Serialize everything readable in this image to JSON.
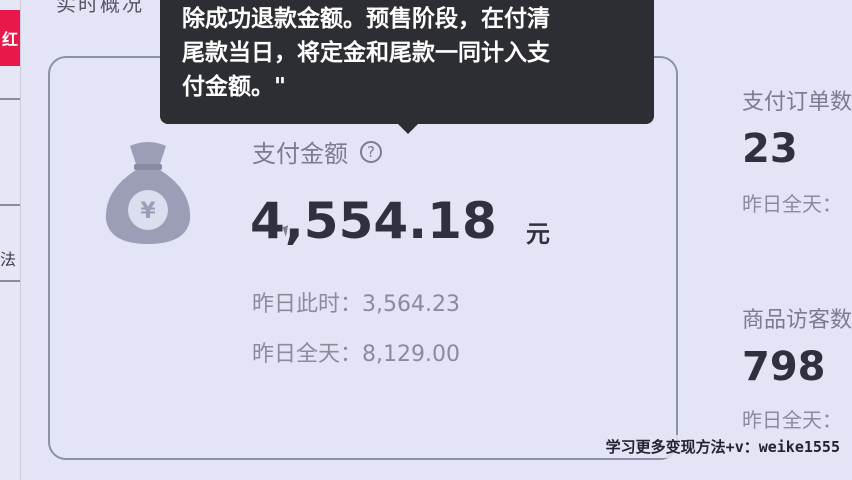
{
  "header": {
    "cut_title": "实时概况",
    "left_tab_label": "红",
    "left_cut_text": "法"
  },
  "tooltip": {
    "lines": [
      "除成功退款金额。预售阶段，在付清",
      "尾款当日，将定金和尾款一同计入支",
      "付金额。\""
    ]
  },
  "payment_card": {
    "icon": "money-bag-yuan-icon",
    "title": "支付金额",
    "help_icon": "question-circle-icon",
    "value": "4,554.18",
    "unit": "元",
    "yesterday_same_time_label": "昨日此时：",
    "yesterday_same_time_value": "3,564.23",
    "yesterday_full_label": "昨日全天：",
    "yesterday_full_value": "8,129.00"
  },
  "side_metrics": [
    {
      "title": "支付订单数",
      "value": "23",
      "sub": "昨日全天："
    },
    {
      "title": "商品访客数",
      "value": "798",
      "sub": "昨日全天："
    }
  ],
  "watermark": "学习更多变现方法+v：weike1555",
  "colors": {
    "background": "#e3e4f5",
    "tooltip_bg": "#2d2e33",
    "red_tab": "#e8194a",
    "primary_text": "#2f3040",
    "muted_text": "#7b7c8e"
  }
}
